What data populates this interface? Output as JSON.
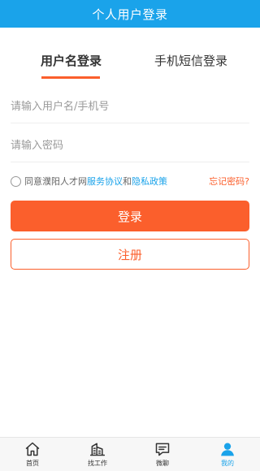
{
  "header": {
    "title": "个人用户登录"
  },
  "tabs": [
    {
      "label": "用户名登录",
      "active": true
    },
    {
      "label": "手机短信登录",
      "active": false
    }
  ],
  "form": {
    "username_placeholder": "请输入用户名/手机号",
    "password_placeholder": "请输入密码"
  },
  "agreement": {
    "prefix": "同意濮阳人才网",
    "service_link": "服务协议",
    "and": "和",
    "privacy_link": "隐私政策",
    "checked": false
  },
  "forgot_password": "忘记密码?",
  "buttons": {
    "login": "登录",
    "register": "注册"
  },
  "bottom_nav": [
    {
      "label": "首页",
      "icon": "home-icon",
      "active": false
    },
    {
      "label": "找工作",
      "icon": "building-icon",
      "active": false
    },
    {
      "label": "微聊",
      "icon": "chat-icon",
      "active": false
    },
    {
      "label": "我的",
      "icon": "user-icon",
      "active": true
    }
  ],
  "colors": {
    "primary": "#1aa3ea",
    "accent": "#fb5f2c",
    "nav_inactive": "#333333"
  }
}
